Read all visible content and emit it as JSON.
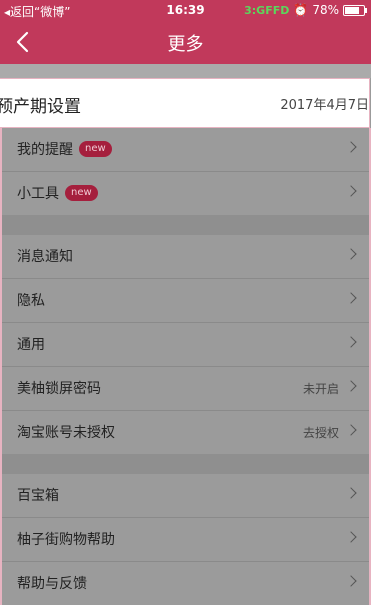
{
  "status_bar": {
    "back_text": "◂返回“微博”",
    "time": "16:39",
    "carrier": "3:GFFD",
    "battery": "78%",
    "battery_level": 0.78
  },
  "nav": {
    "title": "更多"
  },
  "highlight_row": {
    "label": "预产期设置",
    "value": "2017年4月7日 "
  },
  "groups": [
    {
      "rows": [
        {
          "label": "我的提醒",
          "badge": "new"
        },
        {
          "label": "小工具",
          "badge": "new"
        }
      ]
    },
    {
      "rows": [
        {
          "label": "消息通知"
        },
        {
          "label": "隐私"
        },
        {
          "label": "通用"
        },
        {
          "label": "美柚锁屏密码",
          "value": "未开启"
        },
        {
          "label": "淘宝账号未授权",
          "value": "去授权"
        }
      ]
    },
    {
      "rows": [
        {
          "label": "百宝箱"
        },
        {
          "label": "柚子街购物帮助"
        },
        {
          "label": "帮助与反馈"
        }
      ]
    }
  ],
  "colors": {
    "brand": "#c1395b",
    "badge": "#a51f3d",
    "overlay": "#9b9b9b"
  }
}
